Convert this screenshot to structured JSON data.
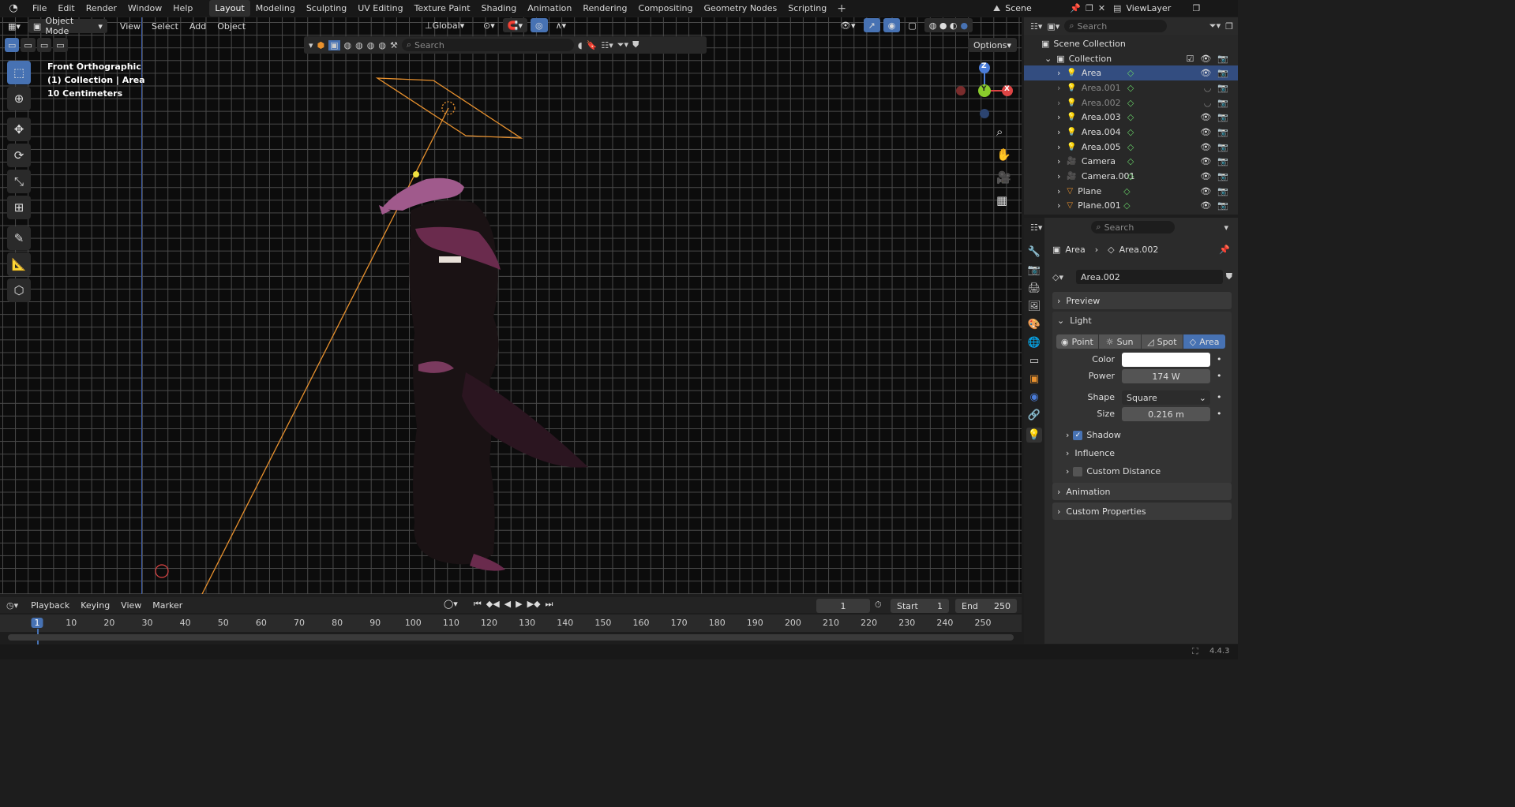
{
  "menus": [
    "File",
    "Edit",
    "Render",
    "Window",
    "Help"
  ],
  "workspace_tabs": [
    "Layout",
    "Modeling",
    "Sculpting",
    "UV Editing",
    "Texture Paint",
    "Shading",
    "Animation",
    "Rendering",
    "Compositing",
    "Geometry Nodes",
    "Scripting"
  ],
  "scene_name": "Scene",
  "viewlayer_name": "ViewLayer",
  "viewport": {
    "mode": "Object Mode",
    "header_menus": [
      "View",
      "Select",
      "Add",
      "Object"
    ],
    "orientation": "Global",
    "search_placeholder": "Search",
    "options_label": "Options",
    "info_line1": "Front Orthographic",
    "info_line2": "(1) Collection | Area",
    "info_line3": "10 Centimeters",
    "gizmo_z": "Z",
    "gizmo_y": "Y",
    "gizmo_x": "X"
  },
  "outliner": {
    "search_placeholder": "Search",
    "scene_collection": "Scene Collection",
    "collection": "Collection",
    "items": [
      {
        "name": "Area",
        "selected": true
      },
      {
        "name": "Area.001",
        "dim": true
      },
      {
        "name": "Area.002",
        "dim": true
      },
      {
        "name": "Area.003"
      },
      {
        "name": "Area.004"
      },
      {
        "name": "Area.005"
      },
      {
        "name": "Camera"
      },
      {
        "name": "Camera.001"
      },
      {
        "name": "Plane"
      },
      {
        "name": "Plane.001"
      }
    ]
  },
  "properties": {
    "search_placeholder": "Search",
    "breadcrumb_object": "Area",
    "breadcrumb_data": "Area.002",
    "datablock_name": "Area.002",
    "panel_preview": "Preview",
    "panel_light": "Light",
    "light_types": [
      "Point",
      "Sun",
      "Spot",
      "Area"
    ],
    "active_light_type": "Area",
    "color_label": "Color",
    "power_label": "Power",
    "power_value": "174 W",
    "shape_label": "Shape",
    "shape_value": "Square",
    "size_label": "Size",
    "size_value": "0.216 m",
    "shadow_label": "Shadow",
    "influence_label": "Influence",
    "custom_distance_label": "Custom Distance",
    "panel_animation": "Animation",
    "panel_custom_props": "Custom Properties"
  },
  "timeline": {
    "menus": [
      "Playback",
      "Keying",
      "View",
      "Marker"
    ],
    "current_frame": "1",
    "start_label": "Start",
    "start_value": "1",
    "end_label": "End",
    "end_value": "250",
    "ticks": [
      "1",
      "10",
      "20",
      "30",
      "40",
      "50",
      "60",
      "70",
      "80",
      "90",
      "100",
      "110",
      "120",
      "130",
      "140",
      "150",
      "160",
      "170",
      "180",
      "190",
      "200",
      "210",
      "220",
      "230",
      "240",
      "250"
    ]
  },
  "status": {
    "version": "4.4.3"
  },
  "colors": {
    "accent": "#4772b3",
    "selected_row": "#334d80",
    "light_orange": "#e8912e",
    "bg_dark": "#1d1d1d"
  }
}
